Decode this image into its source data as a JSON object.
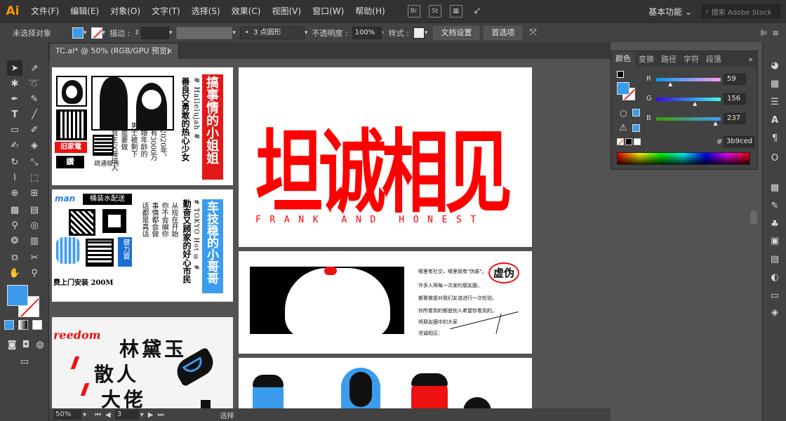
{
  "app": {
    "logo": "Ai"
  },
  "menu": [
    "文件(F)",
    "编辑(E)",
    "对象(O)",
    "文字(T)",
    "选择(S)",
    "效果(C)",
    "视图(V)",
    "窗口(W)",
    "帮助(H)"
  ],
  "top_icons": [
    "Br",
    "St"
  ],
  "workspace": "基本功能",
  "search_placeholder": "搜索 Adobe Stock",
  "control": {
    "selection": "未选择对象",
    "stroke_label": "描边 :",
    "brush": "3 点圆形",
    "opacity_label": "不透明度 :",
    "opacity": "100%",
    "style_label": "样式 :",
    "doc_setup": "文档设置",
    "prefs": "首选项"
  },
  "tab": {
    "title": "TC.ai* @ 50% (RGB/GPU 预览)",
    "close": "×"
  },
  "color_panel": {
    "tabs": [
      "颜色",
      "变换",
      "路径",
      "字符",
      "段落"
    ],
    "r_label": "R",
    "g_label": "G",
    "b_label": "B",
    "r": "59",
    "g": "156",
    "b": "237",
    "r_frac": 0.23,
    "g_frac": 0.61,
    "b_frac": 0.93,
    "hex_label": "#",
    "hex": "3b9ced",
    "fill_color": "#3b9ced"
  },
  "status": {
    "zoom": "50%",
    "page": "3",
    "mode": "选择"
  },
  "art": {
    "t1_heading": "搞事情的小姐姐",
    "t1_line1": "善良又勇敢的热心少女",
    "t1_tag": "# Hallelujah #",
    "t1_body1": "到2020年，",
    "t1_body2": "将有3000万",
    "t1_body3": "适婚年龄的",
    "t1_body4": "男士被剩下",
    "t1_body5": "还是要做",
    "t1_body6": "社会主义接班人",
    "t1_promo1": "旧家電",
    "t1_promo2": "疏通吸污",
    "t1_promo3": "鑽",
    "t2_heading": "车技稳的小哥哥",
    "t2_line1": "勤奋又顾家的好心市民",
    "t2_tag": "# TOKYO Hot ® #",
    "t2_body1": "从现在开始",
    "t2_body2": "你不会编你",
    "t2_body3": "事情都会做",
    "t2_body4": "话都是真话",
    "t2_banner": "桶装水配送",
    "t2_side": "健力寶",
    "t2_footer": "费上门安装 200M",
    "t2_brand": "man",
    "t3_freedom": "reedom",
    "t3_text1": "林黛玉",
    "t3_text2": "散人",
    "t3_text3": "大佬",
    "title_cn": "坦诚相见",
    "title_en": "FRANK AND HONEST",
    "card_title": "虚伪",
    "card_lines": [
      "哪里有社交，哪里就有\"伪装\"。",
      "许多人将每一次发的朋友圈，",
      "都看做是对我们友谊进行一次检验。",
      "你所看到的都是别人希望你看到的。",
      "将朋友圈中的大家",
      "坦诚相见："
    ]
  }
}
